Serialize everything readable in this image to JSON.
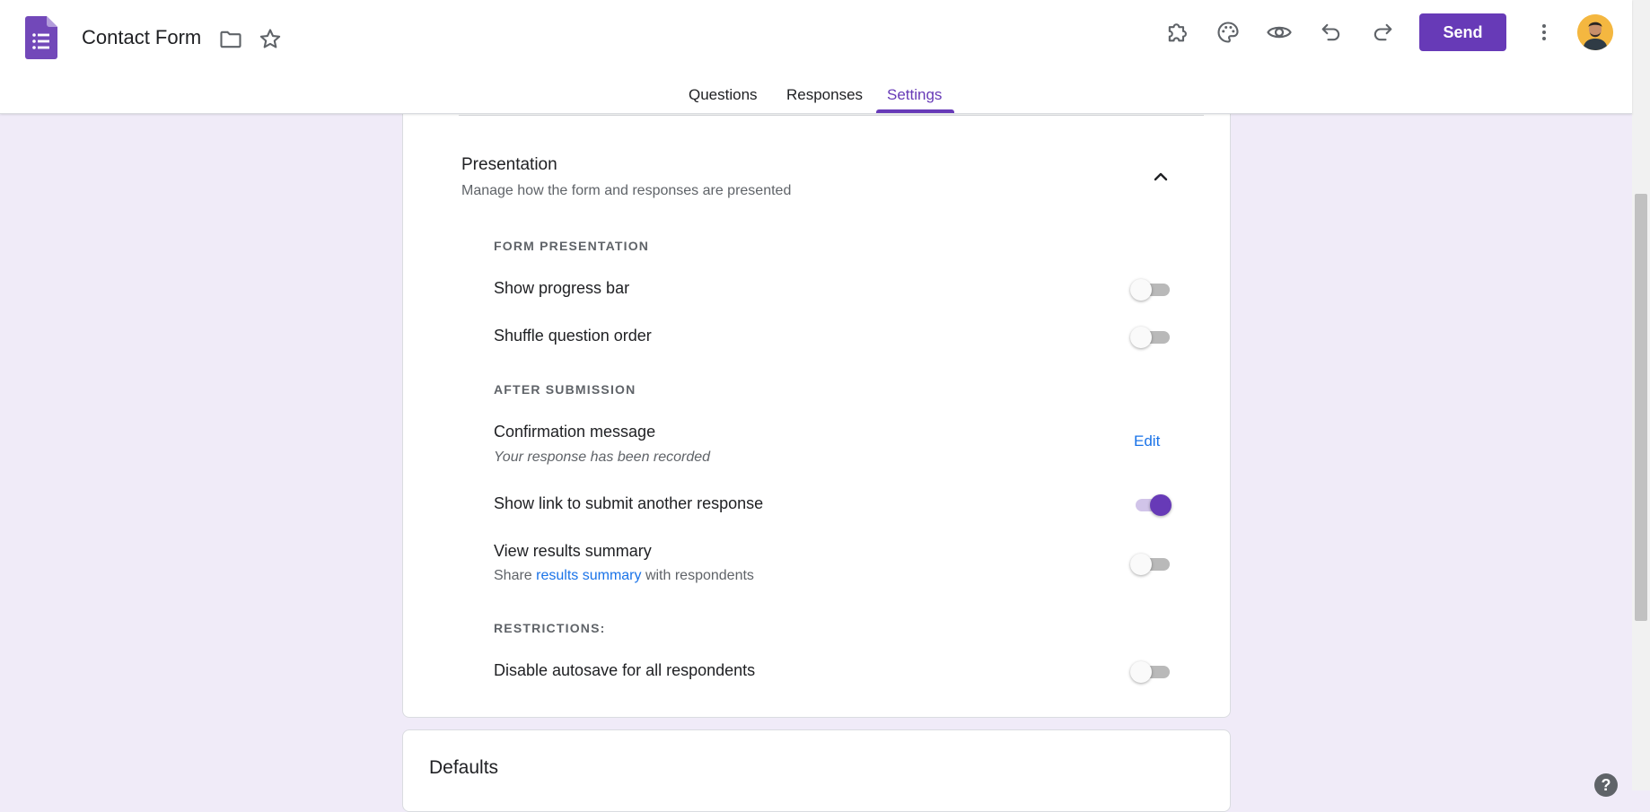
{
  "header": {
    "title": "Contact Form",
    "send_label": "Send",
    "icons": [
      "forms-logo-icon",
      "folder-icon",
      "star-icon",
      "addons-icon",
      "palette-icon",
      "preview-eye-icon",
      "undo-icon",
      "redo-icon",
      "more-vert-icon",
      "avatar"
    ]
  },
  "tabs": [
    {
      "label": "Questions",
      "active": false
    },
    {
      "label": "Responses",
      "active": false
    },
    {
      "label": "Settings",
      "active": true
    }
  ],
  "presentation": {
    "title": "Presentation",
    "subtitle": "Manage how the form and responses are presented",
    "form_presentation_label": "FORM PRESENTATION",
    "show_progress_bar": {
      "label": "Show progress bar",
      "on": false
    },
    "shuffle_question_order": {
      "label": "Shuffle question order",
      "on": false
    },
    "after_submission_label": "AFTER SUBMISSION",
    "confirmation_message": {
      "label": "Confirmation message",
      "value": "Your response has been recorded",
      "edit_label": "Edit"
    },
    "show_link_another": {
      "label": "Show link to submit another response",
      "on": true
    },
    "view_results_summary": {
      "label": "View results summary",
      "sub_prefix": "Share ",
      "sub_link": "results summary",
      "sub_suffix": " with respondents",
      "on": false
    },
    "restrictions_label": "RESTRICTIONS:",
    "disable_autosave": {
      "label": "Disable autosave for all respondents",
      "on": false
    }
  },
  "defaults": {
    "title": "Defaults"
  },
  "help": {
    "label": "?"
  },
  "colors": {
    "accent": "#673ab7",
    "background": "#f0ebf8",
    "link": "#1a73e8"
  }
}
